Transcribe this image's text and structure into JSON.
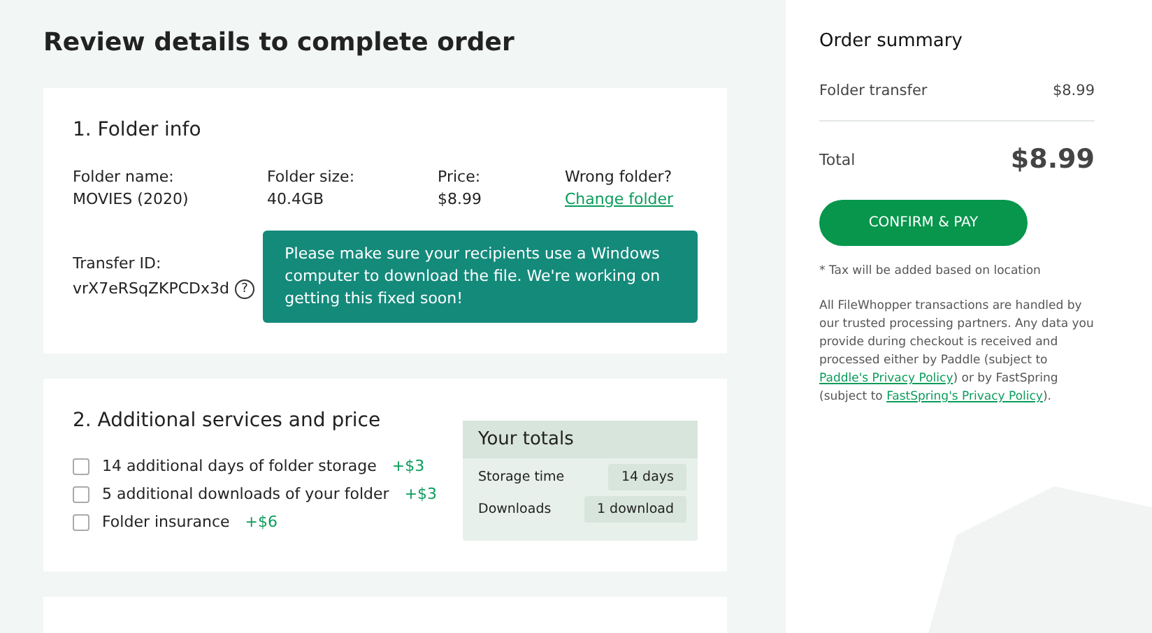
{
  "page_title": "Review details to complete order",
  "folder_info": {
    "title": "1. Folder info",
    "fields": [
      {
        "label": "Folder name:",
        "value": "MOVIES (2020)",
        "kind": "text"
      },
      {
        "label": "Folder size:",
        "value": "40.4GB",
        "kind": "text"
      },
      {
        "label": "Price:",
        "value": "$8.99",
        "kind": "text"
      },
      {
        "label": "Wrong folder?",
        "value": "Change folder",
        "kind": "link"
      }
    ],
    "transfer_label": "Transfer ID:",
    "transfer_id": "vrX7eRSqZKPCDx3d",
    "help_icon": "?",
    "notice": "Please make sure your recipients use a Windows computer to download the file. We're working on getting this fixed soon!"
  },
  "services": {
    "title": "2. Additional services and price",
    "options": [
      {
        "label": "14 additional days of folder storage",
        "price": "+$3",
        "checked": false
      },
      {
        "label": "5 additional downloads of your folder",
        "price": "+$3",
        "checked": false
      },
      {
        "label": "Folder insurance",
        "price": "+$6",
        "checked": false
      }
    ],
    "totals": {
      "title": "Your totals",
      "rows": [
        {
          "label": "Storage time",
          "value": "14 days"
        },
        {
          "label": "Downloads",
          "value": "1 download"
        }
      ]
    }
  },
  "summary": {
    "title": "Order summary",
    "line": {
      "label": "Folder transfer",
      "value": "$8.99"
    },
    "total_label": "Total",
    "total_value": "$8.99",
    "button": "CONFIRM & PAY",
    "tax_note": "* Tax will be added based on location",
    "legal": [
      {
        "kind": "text",
        "text": "All FileWhopper transactions are handled by our trusted processing partners. Any data you provide during checkout is received and processed either by Paddle (subject to "
      },
      {
        "kind": "link",
        "text": "Paddle's Privacy Policy"
      },
      {
        "kind": "text",
        "text": ") or by FastSpring (subject to "
      },
      {
        "kind": "link",
        "text": "FastSpring's Privacy Policy"
      },
      {
        "kind": "text",
        "text": ")."
      }
    ]
  }
}
